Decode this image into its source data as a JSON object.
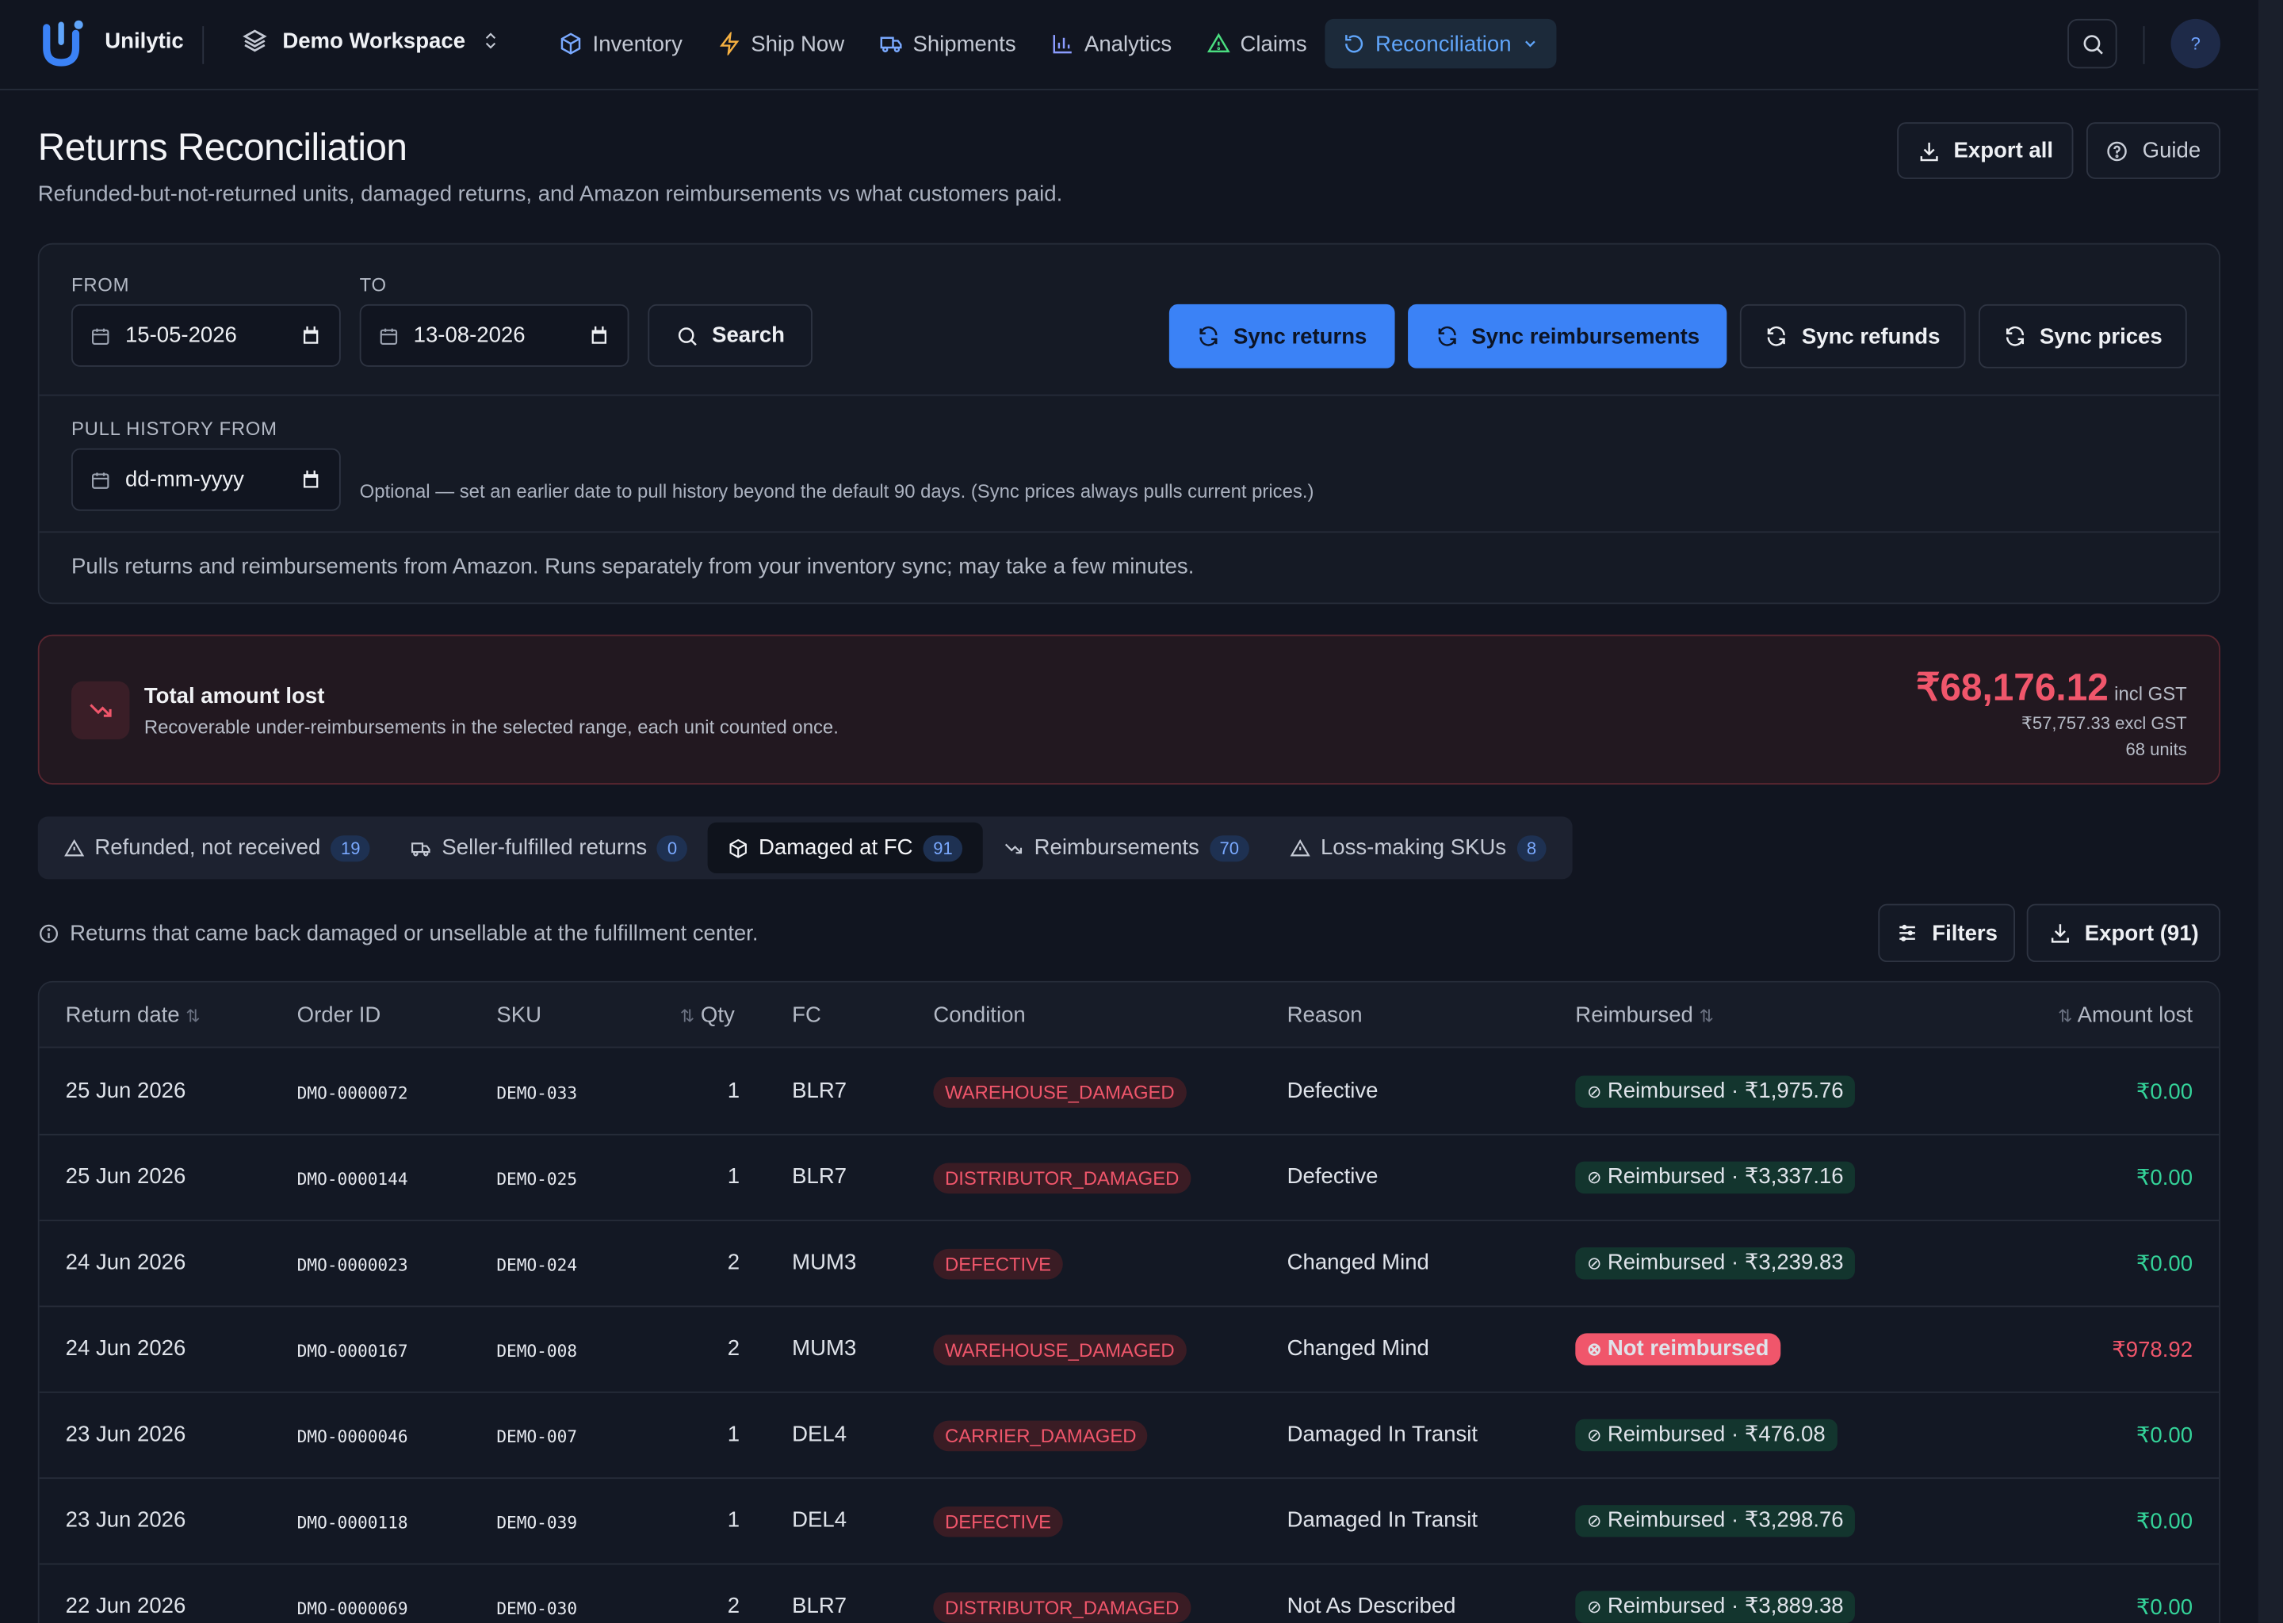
{
  "brand": "Unilytic",
  "workspace": "Demo Workspace",
  "nav": [
    "Inventory",
    "Ship Now",
    "Shipments",
    "Analytics",
    "Claims",
    "Reconciliation"
  ],
  "header": {
    "title": "Returns Reconciliation",
    "subtitle": "Refunded-but-not-returned units, damaged returns, and Amazon reimbursements vs what customers paid.",
    "export_all": "Export all",
    "guide": "Guide"
  },
  "help_label": "?",
  "filters": {
    "from_label": "FROM",
    "from_value": "15-05-2026",
    "to_label": "TO",
    "to_value": "13-08-2026",
    "search": "Search",
    "sync_returns": "Sync returns",
    "sync_reimbursements": "Sync reimbursements",
    "sync_refunds": "Sync refunds",
    "sync_prices": "Sync prices",
    "pull_label": "PULL HISTORY FROM",
    "pull_placeholder": "dd-mm-yyyy",
    "pull_hint": "Optional — set an earlier date to pull history beyond the default 90 days. (Sync prices always pulls current prices.)",
    "note": "Pulls returns and reimbursements from Amazon. Runs separately from your inventory sync; may take a few minutes."
  },
  "loss": {
    "title": "Total amount lost",
    "subtitle": "Recoverable under-reimbursements in the selected range, each unit counted once.",
    "amount": "₹68,176.12",
    "incl": "incl GST",
    "excl": "₹57,757.33 excl GST",
    "units": "68 units"
  },
  "tabs": [
    {
      "label": "Refunded, not received",
      "count": "19"
    },
    {
      "label": "Seller-fulfilled returns",
      "count": "0"
    },
    {
      "label": "Damaged at FC",
      "count": "91"
    },
    {
      "label": "Reimbursements",
      "count": "70"
    },
    {
      "label": "Loss-making SKUs",
      "count": "8"
    }
  ],
  "info": "Returns that came back damaged or unsellable at the fulfillment center.",
  "filters_btn": "Filters",
  "export_btn": "Export (91)",
  "columns": [
    "Return date",
    "Order ID",
    "SKU",
    "Qty",
    "FC",
    "Condition",
    "Reason",
    "Reimbursed",
    "Amount lost"
  ],
  "rows": [
    {
      "date": "25 Jun 2026",
      "order": "DMO-0000072",
      "sku": "DEMO-033",
      "qty": "1",
      "fc": "BLR7",
      "cond": "WAREHOUSE_DAMAGED",
      "reason": "Defective",
      "reimb": "Reimbursed · ₹1,975.76",
      "amt": "₹0.00"
    },
    {
      "date": "25 Jun 2026",
      "order": "DMO-0000144",
      "sku": "DEMO-025",
      "qty": "1",
      "fc": "BLR7",
      "cond": "DISTRIBUTOR_DAMAGED",
      "reason": "Defective",
      "reimb": "Reimbursed · ₹3,337.16",
      "amt": "₹0.00"
    },
    {
      "date": "24 Jun 2026",
      "order": "DMO-0000023",
      "sku": "DEMO-024",
      "qty": "2",
      "fc": "MUM3",
      "cond": "DEFECTIVE",
      "reason": "Changed Mind",
      "reimb": "Reimbursed · ₹3,239.83",
      "amt": "₹0.00"
    },
    {
      "date": "24 Jun 2026",
      "order": "DMO-0000167",
      "sku": "DEMO-008",
      "qty": "2",
      "fc": "MUM3",
      "cond": "WAREHOUSE_DAMAGED",
      "reason": "Changed Mind",
      "reimb": "Not reimbursed",
      "amt": "₹978.92"
    },
    {
      "date": "23 Jun 2026",
      "order": "DMO-0000046",
      "sku": "DEMO-007",
      "qty": "1",
      "fc": "DEL4",
      "cond": "CARRIER_DAMAGED",
      "reason": "Damaged In Transit",
      "reimb": "Reimbursed · ₹476.08",
      "amt": "₹0.00"
    },
    {
      "date": "23 Jun 2026",
      "order": "DMO-0000118",
      "sku": "DEMO-039",
      "qty": "1",
      "fc": "DEL4",
      "cond": "DEFECTIVE",
      "reason": "Damaged In Transit",
      "reimb": "Reimbursed · ₹3,298.76",
      "amt": "₹0.00"
    },
    {
      "date": "22 Jun 2026",
      "order": "DMO-0000069",
      "sku": "DEMO-030",
      "qty": "2",
      "fc": "BLR7",
      "cond": "DISTRIBUTOR_DAMAGED",
      "reason": "Not As Described",
      "reimb": "Reimbursed · ₹3,889.38",
      "amt": "₹0.00"
    }
  ],
  "colors": {
    "accent": "#3b82f6",
    "danger": "#f0566b",
    "success": "#34d399",
    "background": "#111520"
  }
}
